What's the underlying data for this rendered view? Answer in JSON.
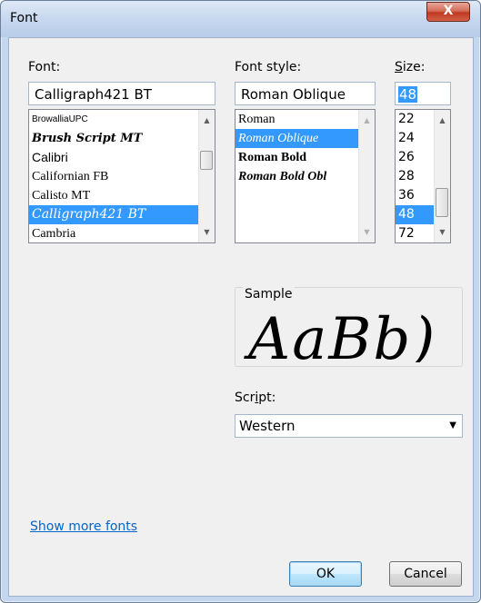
{
  "window": {
    "title": "Font",
    "close_glyph": "X"
  },
  "font": {
    "label": "Font:",
    "value": "Calligraph421 BT",
    "items": [
      "BrowalliaUPC",
      "Brush Script MT",
      "Calibri",
      "Californian FB",
      "Calisto MT",
      "Calligraph421 BT",
      "Cambria"
    ],
    "selected_index": 5
  },
  "style": {
    "label": "Font style:",
    "value": "Roman Oblique",
    "items": [
      "Roman",
      "Roman Oblique",
      "Roman Bold",
      "Roman Bold Obl"
    ],
    "selected_index": 1
  },
  "size": {
    "label": "Size:",
    "value": "48",
    "items": [
      "22",
      "24",
      "26",
      "28",
      "36",
      "48",
      "72"
    ],
    "selected_index": 5
  },
  "sample": {
    "label": "Sample",
    "text": "AaBb)"
  },
  "script": {
    "label": "Script:",
    "value": "Western"
  },
  "links": {
    "show_more": "Show more fonts"
  },
  "buttons": {
    "ok": "OK",
    "cancel": "Cancel"
  },
  "colors": {
    "selection": "#3399ff",
    "link": "#0066cc",
    "close_button": "#c0391f"
  }
}
